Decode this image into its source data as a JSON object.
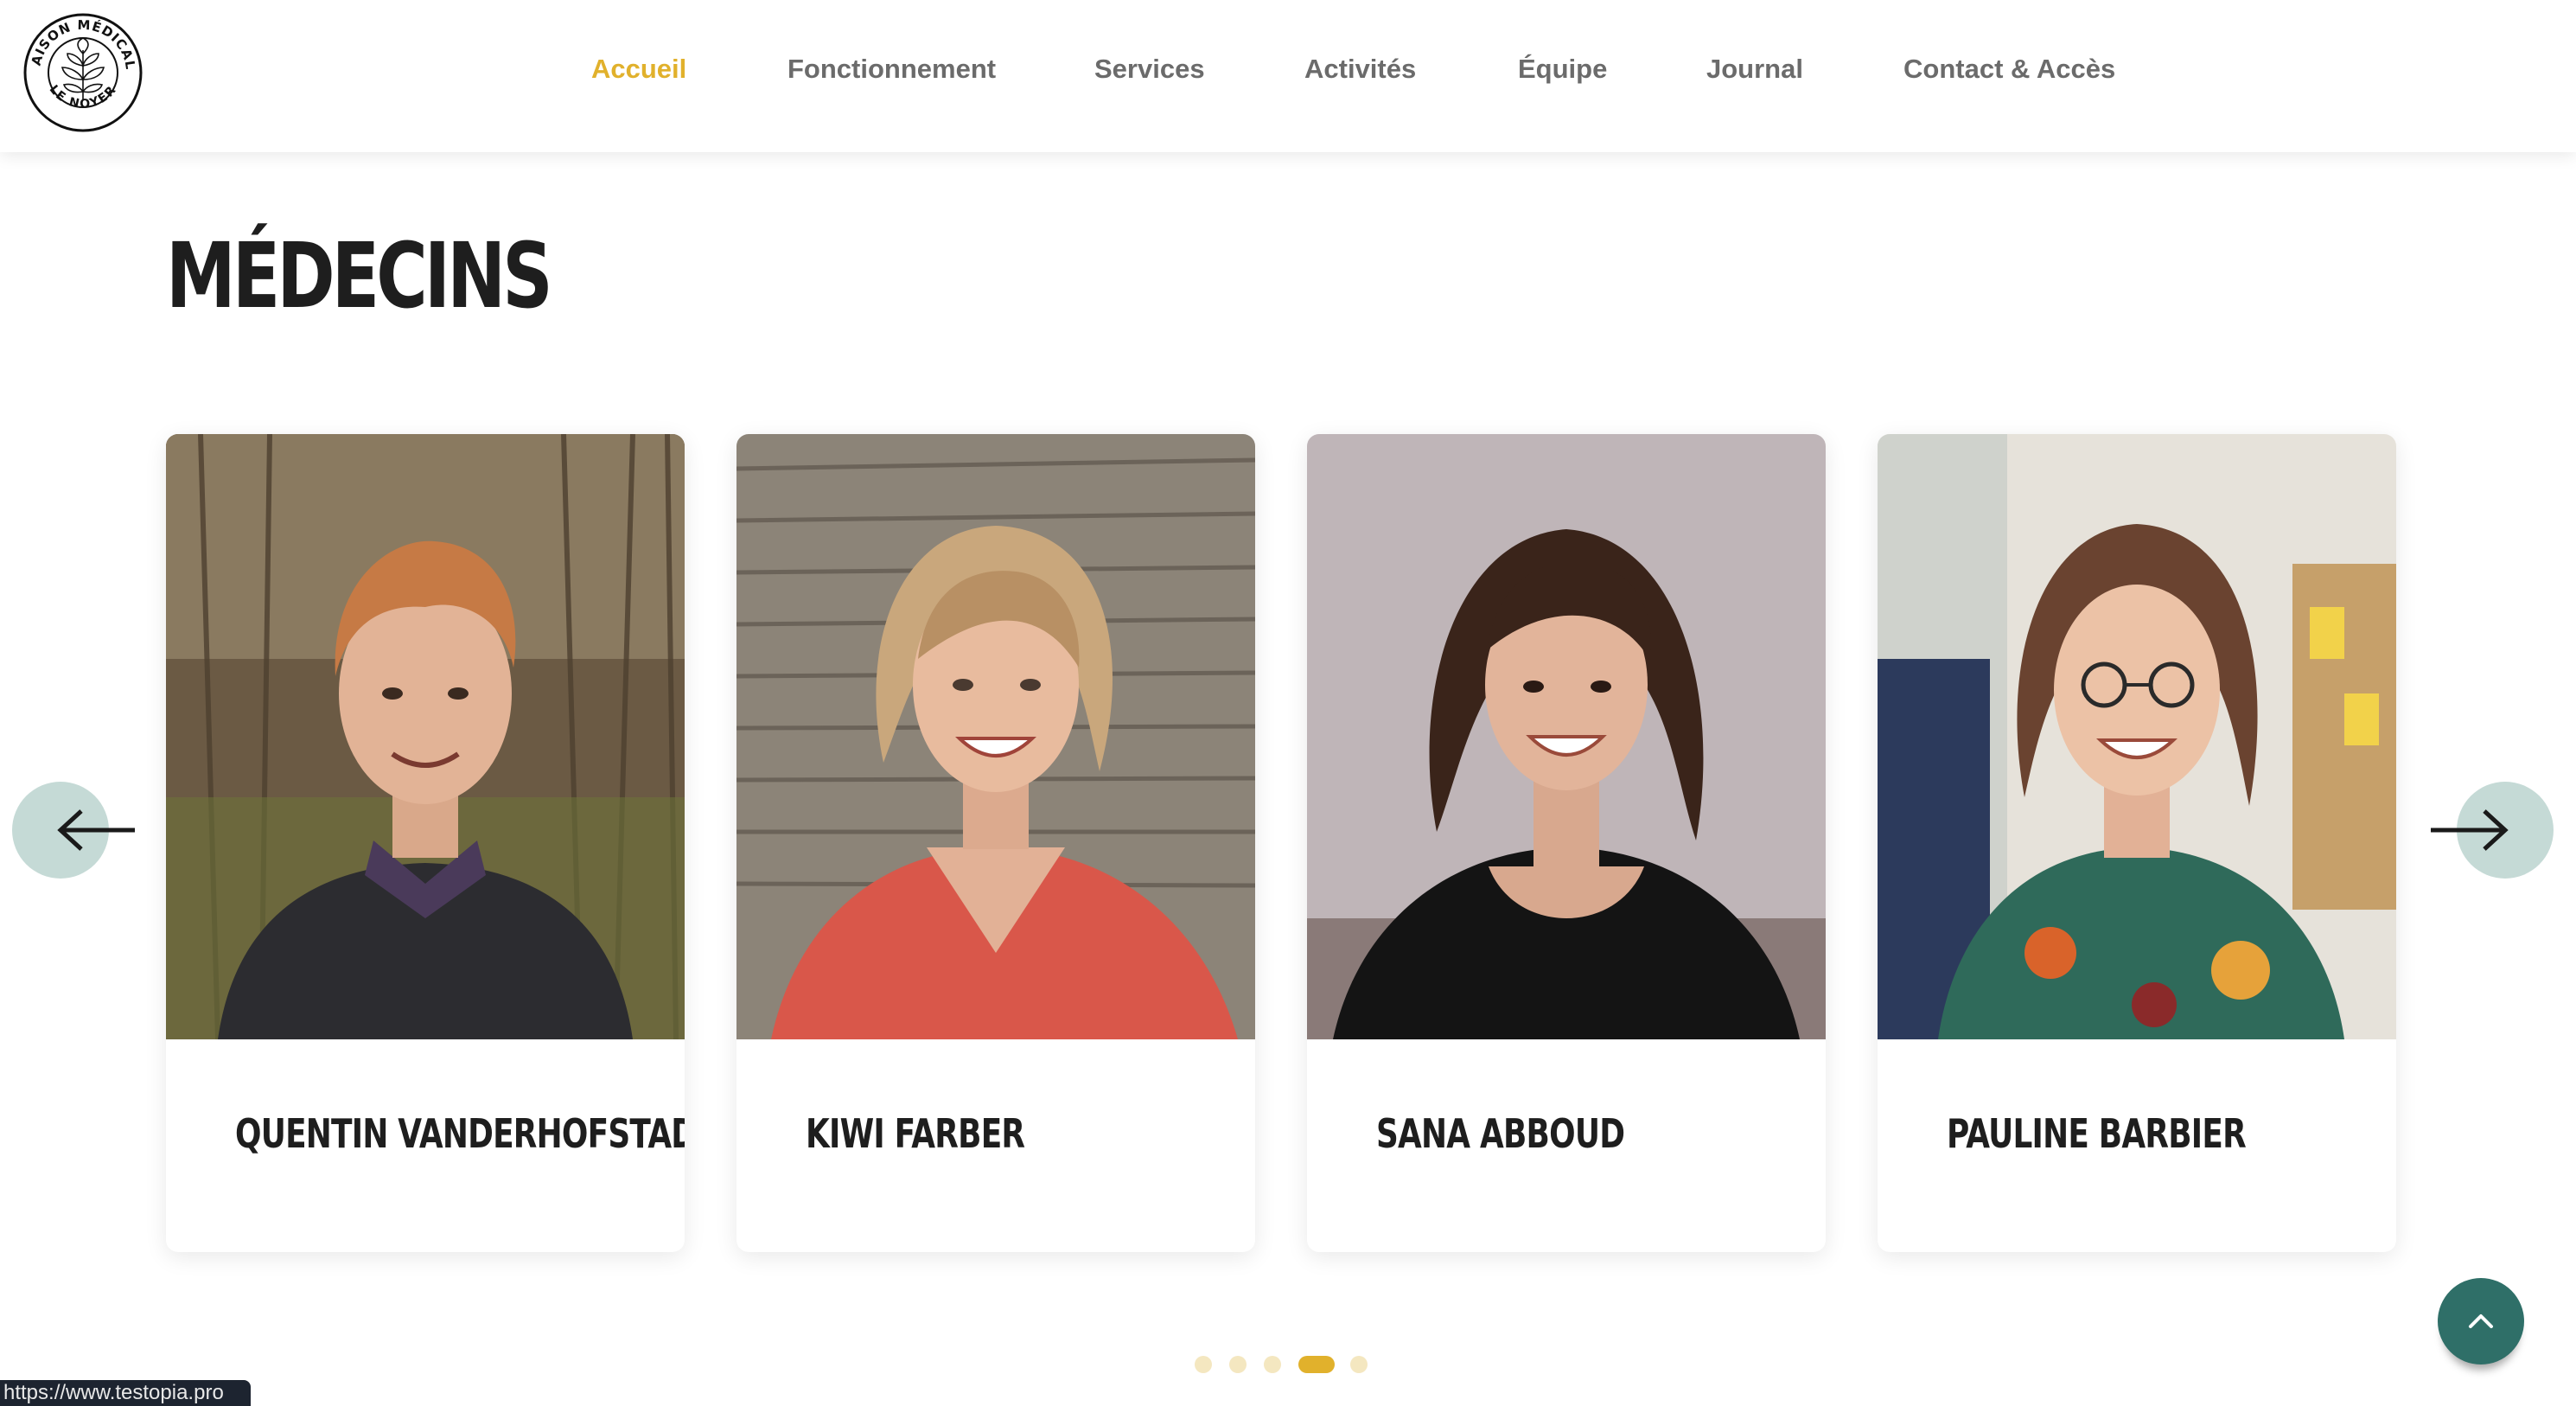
{
  "header": {
    "logo_text_top": "MAISON MÉDICALE",
    "logo_text_bottom": "LE NOYER",
    "nav": [
      {
        "label": "Accueil",
        "active": true
      },
      {
        "label": "Fonctionnement",
        "active": false
      },
      {
        "label": "Services",
        "active": false
      },
      {
        "label": "Activités",
        "active": false
      },
      {
        "label": "Équipe",
        "active": false
      },
      {
        "label": "Journal",
        "active": false
      },
      {
        "label": "Contact & Accès",
        "active": false
      }
    ]
  },
  "section": {
    "title": "MÉDECINS"
  },
  "cards": [
    {
      "name": "QUENTIN VANDERHOFSTADT"
    },
    {
      "name": "KIWI FARBER"
    },
    {
      "name": "SANA ABBOUD"
    },
    {
      "name": "PAULINE BARBIER"
    }
  ],
  "carousel": {
    "dot_count": 5,
    "active_dot": 4,
    "prev_icon": "arrow-left-icon",
    "next_icon": "arrow-right-icon"
  },
  "status_bar": {
    "url": "https://www.testopia.pro"
  },
  "colors": {
    "accent": "#e1b12c",
    "nav_text": "#6b6b6b",
    "heading": "#1e1e1e",
    "arrow_bg": "#c5dad6",
    "to_top_bg": "#2f6f68"
  }
}
